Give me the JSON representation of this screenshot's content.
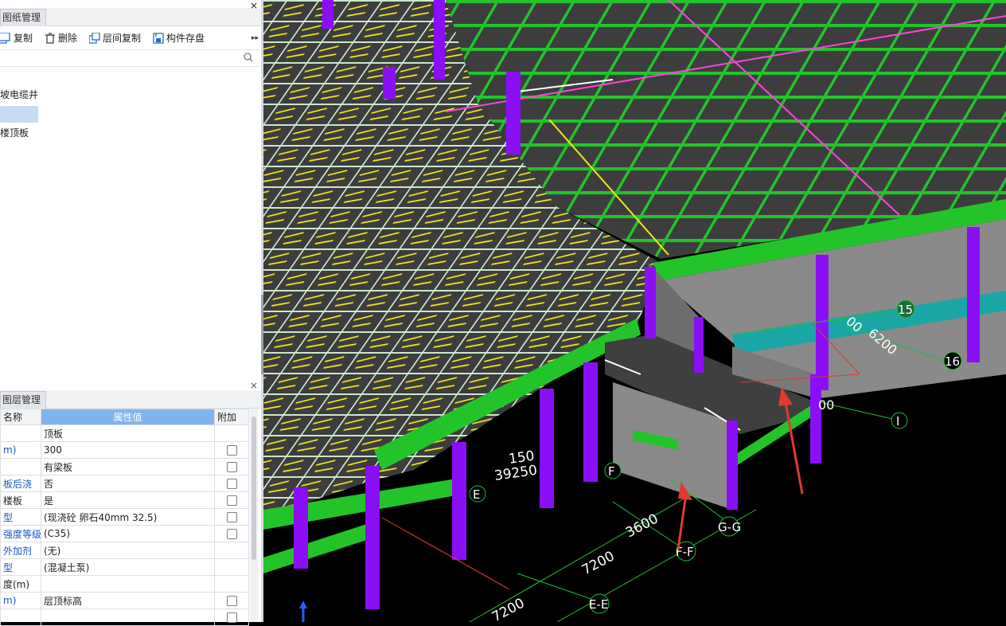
{
  "drawings_panel": {
    "title": "图纸管理",
    "close": "×",
    "toolbar": {
      "copy": "复制",
      "delete": "删除",
      "floor_copy": "层间复制",
      "save": "构件存盘",
      "more": "▸▸"
    },
    "tree": [
      "坡电缆井",
      "",
      "楼顶板"
    ]
  },
  "layers_panel": {
    "title": "图层管理",
    "close": "×",
    "columns": [
      "名称",
      "属性值",
      "附加"
    ],
    "rows": [
      {
        "name": "",
        "value": "顶板",
        "checkbox": false,
        "blue": false
      },
      {
        "name": "m)",
        "value": "300",
        "checkbox": true,
        "blue": true
      },
      {
        "name": "",
        "value": "有梁板",
        "checkbox": true,
        "blue": false
      },
      {
        "name": "板后浇",
        "value": "否",
        "checkbox": true,
        "blue": true
      },
      {
        "name": "楼板",
        "value": "是",
        "checkbox": true,
        "blue": false
      },
      {
        "name": "型",
        "value": "(现浇砼 卵石40mm 32.5)",
        "checkbox": true,
        "blue": true
      },
      {
        "name": "强度等级",
        "value": "(C35)",
        "checkbox": true,
        "blue": true
      },
      {
        "name": "外加剂",
        "value": "(无)",
        "checkbox": false,
        "blue": true
      },
      {
        "name": "型",
        "value": "(混凝土泵)",
        "checkbox": false,
        "blue": true
      },
      {
        "name": "度(m)",
        "value": "",
        "checkbox": false,
        "blue": false
      },
      {
        "name": "m)",
        "value": "层顶标高",
        "checkbox": true,
        "blue": true
      },
      {
        "name": "",
        "value": "",
        "checkbox": true,
        "blue": false
      }
    ]
  },
  "viewport": {
    "dims": [
      "150",
      "39250",
      "3600",
      "7200",
      "7200",
      "00",
      "6200",
      "00"
    ],
    "axis_labels": [
      "F",
      "E",
      "G-G",
      "F-F",
      "E-E",
      "I",
      "15",
      "16"
    ]
  },
  "colors": {
    "beam": "#22c42a",
    "column": "#8a0ff5",
    "slab": "#3f3f3f",
    "rebar": "#f0e81e",
    "pink_line": "#ff44e0",
    "wall": "#8a8a8a",
    "arrow": "#e4392e",
    "teal": "#1ba6a6"
  }
}
